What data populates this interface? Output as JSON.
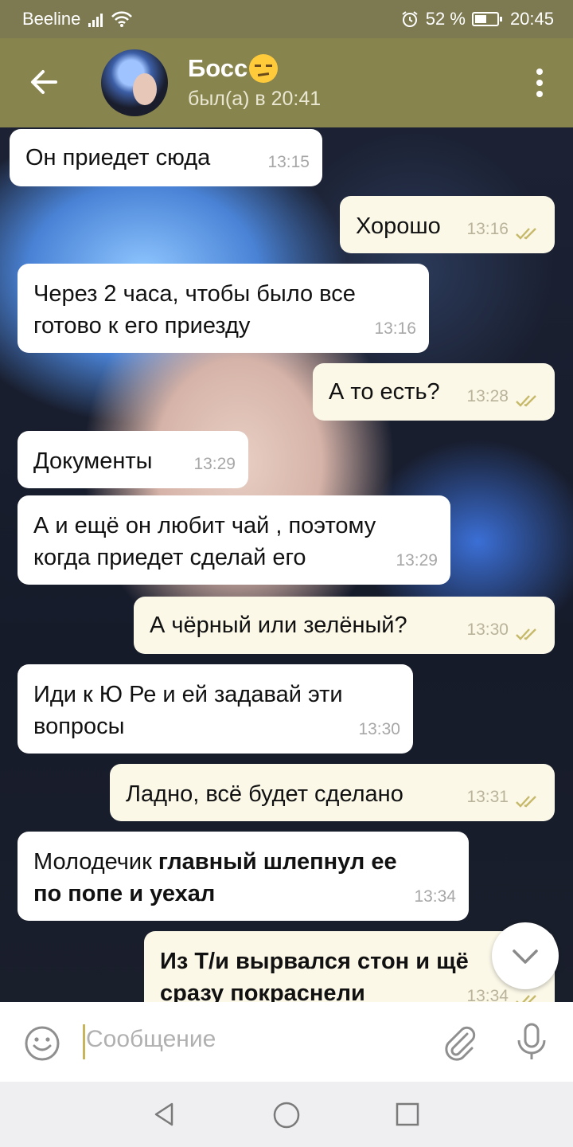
{
  "status_bar": {
    "carrier": "Beeline",
    "battery": "52 %",
    "battery_level": 0.52,
    "time": "20:45"
  },
  "header": {
    "title": "Босс",
    "status": "был(а) в 20:41"
  },
  "messages": [
    {
      "direction": "in",
      "text": "Он приедет сюда",
      "time": "13:15"
    },
    {
      "direction": "out",
      "text": "Хорошо",
      "time": "13:16",
      "read": true
    },
    {
      "direction": "in",
      "lines": [
        "Через 2 часа, чтобы было все",
        "готово к его приезду"
      ],
      "time": "13:16"
    },
    {
      "direction": "out",
      "text": "А то есть?",
      "time": "13:28",
      "read": true
    },
    {
      "direction": "in",
      "text": "Документы",
      "time": "13:29"
    },
    {
      "direction": "in",
      "lines": [
        "А и ещё он любит чай , поэтому",
        "когда приедет сделай его"
      ],
      "time": "13:29"
    },
    {
      "direction": "out",
      "text": "А чёрный или зелёный?",
      "time": "13:30",
      "read": true
    },
    {
      "direction": "in",
      "lines": [
        "Иди к Ю Ре и ей задавай эти",
        "вопросы"
      ],
      "time": "13:30"
    },
    {
      "direction": "out",
      "text": "Ладно, всё будет сделано",
      "time": "13:31",
      "read": true
    },
    {
      "direction": "in",
      "line1_normal": "Молодечик ",
      "line1_bold": "главный шлепнул ее",
      "line2_bold": "по попе и уехал",
      "time": "13:34"
    },
    {
      "direction": "out",
      "lines": [
        "Из Т/и вырвался стон и щё",
        "сразу покраснели"
      ],
      "time": "13:34",
      "read": true
    }
  ],
  "composer": {
    "placeholder": "Сообщение"
  },
  "icons": {
    "back": "arrow-left-icon",
    "menu": "more-vert-icon",
    "emoji": "smile-icon",
    "attach": "paperclip-icon",
    "mic": "microphone-icon",
    "scroll": "chevron-down-icon"
  },
  "colors": {
    "header": "#88844e",
    "status_bar": "#7d7a52",
    "outgoing_bubble": "#fbf8e8",
    "incoming_bubble": "#ffffff",
    "read_ticks": "#c6b96a"
  }
}
